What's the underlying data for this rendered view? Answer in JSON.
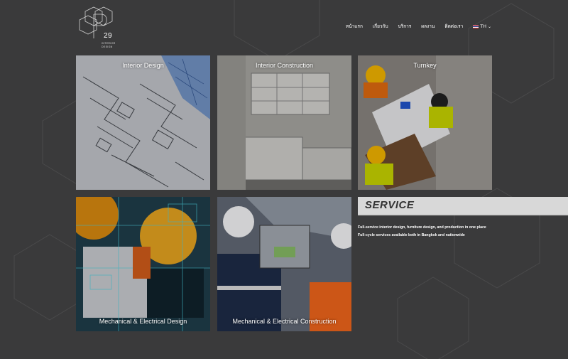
{
  "logo": {
    "number": "29",
    "line1": "INTERIOR",
    "line2": "DESIGN"
  },
  "nav": {
    "items": [
      {
        "label": "หน้าแรก"
      },
      {
        "label": "เกี่ยวกับ"
      },
      {
        "label": "บริการ"
      },
      {
        "label": "ผลงาน"
      },
      {
        "label": "ติดต่อเรา"
      }
    ],
    "language": "TH"
  },
  "tiles": [
    {
      "caption": "Interior Design"
    },
    {
      "caption": "Interior Construction"
    },
    {
      "caption": "Turnkey"
    },
    {
      "caption": "Mechanical & Electrical Design"
    },
    {
      "caption": "Mechanical & Electrical Construction"
    }
  ],
  "service": {
    "title": "SERVICE",
    "text1": "Full-service interior design, furniture design, and production in one place",
    "text2": "Full-cycle services available both in Bangkok and nationwide"
  },
  "colors": {
    "background": "#3a3a3b",
    "service_bar": "#d8d8d8",
    "text": "#ffffff"
  }
}
